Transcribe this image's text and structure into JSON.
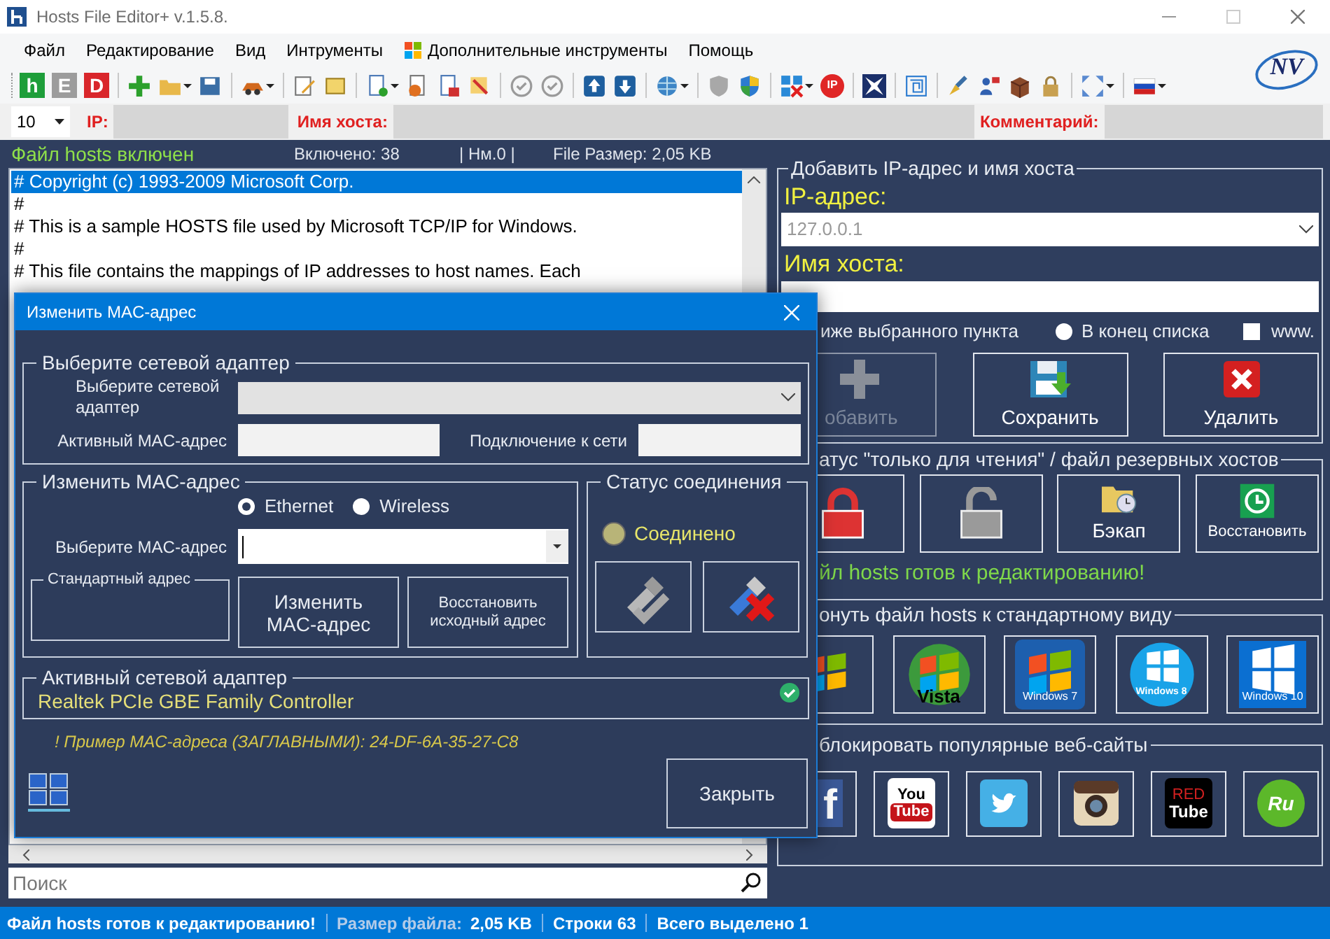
{
  "window": {
    "title": "Hosts File Editor+ v.1.5.8.",
    "logo": "NV"
  },
  "menu": [
    {
      "label": "Файл",
      "kind": "plain"
    },
    {
      "label": "Редактирование",
      "kind": "plain"
    },
    {
      "label": "Вид",
      "kind": "plain"
    },
    {
      "label": "Интрументы",
      "kind": "plain"
    },
    {
      "label": "Дополнительные инструменты",
      "kind": "flag"
    },
    {
      "label": "Помощь",
      "kind": "plain"
    }
  ],
  "toolbar": {
    "letter_buttons": [
      {
        "text": "h",
        "color": "#1e9e3a"
      },
      {
        "text": "E",
        "color": "#9c9c9c"
      },
      {
        "text": "D",
        "color": "#d9262b"
      }
    ],
    "ip_button": "IP"
  },
  "entry_bar": {
    "count": "10",
    "ip_label": "IP:",
    "host_label": "Имя хоста:",
    "comment_label": "Комментарий:"
  },
  "file_panel": {
    "state": "Файл hosts включен",
    "enabled": "Включено: 38",
    "nm": "| Нм.0 |",
    "size": "File Размер: 2,05 KB",
    "lines": [
      {
        "text": "# Copyright (c) 1993-2009 Microsoft Corp.",
        "selected": true
      },
      {
        "text": "#",
        "selected": false
      },
      {
        "text": "# This is a sample HOSTS file used by Microsoft TCP/IP for Windows.",
        "selected": false
      },
      {
        "text": "#",
        "selected": false
      },
      {
        "text": "# This file contains the mappings of IP addresses to host names. Each",
        "selected": false
      }
    ],
    "search": {
      "placeholder": "Поиск"
    }
  },
  "add_host": {
    "title": "Добавить IP-адрес и имя хоста",
    "ip_label": "IP-адрес:",
    "ip_value": "127.0.0.1",
    "host_label": "Имя хоста:",
    "below_label": "иже выбранного пункта",
    "end_option": {
      "label": "В конец списка",
      "selected": false
    },
    "www": {
      "label": "www.",
      "checked": false
    },
    "buttons": [
      {
        "kind": "add",
        "label": "обавить",
        "disabled": true
      },
      {
        "kind": "save",
        "label": "Сохранить",
        "disabled": false
      },
      {
        "kind": "delete",
        "label": "Удалить",
        "disabled": false
      }
    ]
  },
  "readonly_group": {
    "title": "атус \"только для чтения\" / файл резервных хостов",
    "tiles": [
      {
        "kind": "lock"
      },
      {
        "kind": "unlock"
      },
      {
        "kind": "backup",
        "label": "Бэкап"
      },
      {
        "kind": "restore",
        "label": "Восстановить"
      }
    ],
    "message": "йл hosts готов к редактированию!"
  },
  "reset_group": {
    "title": "онуть файл hosts к стандартному виду",
    "tiles": [
      {
        "kind": "xp"
      },
      {
        "kind": "vista",
        "label": "Vista"
      },
      {
        "kind": "win7",
        "label": "Windows 7"
      },
      {
        "kind": "win8",
        "label": "Windows 8"
      },
      {
        "kind": "win10",
        "label": "Windows 10"
      }
    ]
  },
  "block_group": {
    "title": "блокировать популярные веб-сайты",
    "tiles": [
      {
        "kind": "facebook",
        "label": "f"
      },
      {
        "kind": "youtube",
        "label": "You",
        "label_2": "Tube"
      },
      {
        "kind": "twitter"
      },
      {
        "kind": "instagram"
      },
      {
        "kind": "redtube",
        "label": "RED",
        "label_2": "Tube"
      },
      {
        "kind": "ru",
        "label": "Ru"
      }
    ]
  },
  "dialog": {
    "title": "Изменить MAC-адрес",
    "adapter_group": {
      "title": "Выберите сетевой адаптер",
      "adapter_label": "Выберите сетевой адаптер",
      "mac_label": "Активный MAC-адрес",
      "connection_label": "Подключение к сети"
    },
    "change_group": {
      "title": "Изменить MAC-адрес",
      "types": [
        {
          "label": "Ethernet",
          "selected": true
        },
        {
          "label": "Wireless",
          "selected": false
        }
      ],
      "mac_label": "Выберите MAC-адрес",
      "default_title": "Стандартный адрес",
      "change_button": "Изменить MAC-адрес",
      "restore_button": "Восстановить исходный адрес"
    },
    "status_group": {
      "title": "Статус соединения",
      "status": "Соединено",
      "connected": true
    },
    "active_group": {
      "title": "Активный сетевой адаптер",
      "adapter": "Realtek PCIe GBE Family Controller"
    },
    "hint": "! Пример MAC-адреса (ЗАГЛАВНЫМИ):  24-DF-6A-35-27-C8",
    "close_button": "Закрыть"
  },
  "status_bar": [
    {
      "text": "Файл hosts готов к редактированию!"
    },
    {
      "label": "Размер файла:",
      "text": "2,05 KB"
    },
    {
      "text": "Строки 63"
    },
    {
      "text": "Всего выделено 1"
    }
  ]
}
